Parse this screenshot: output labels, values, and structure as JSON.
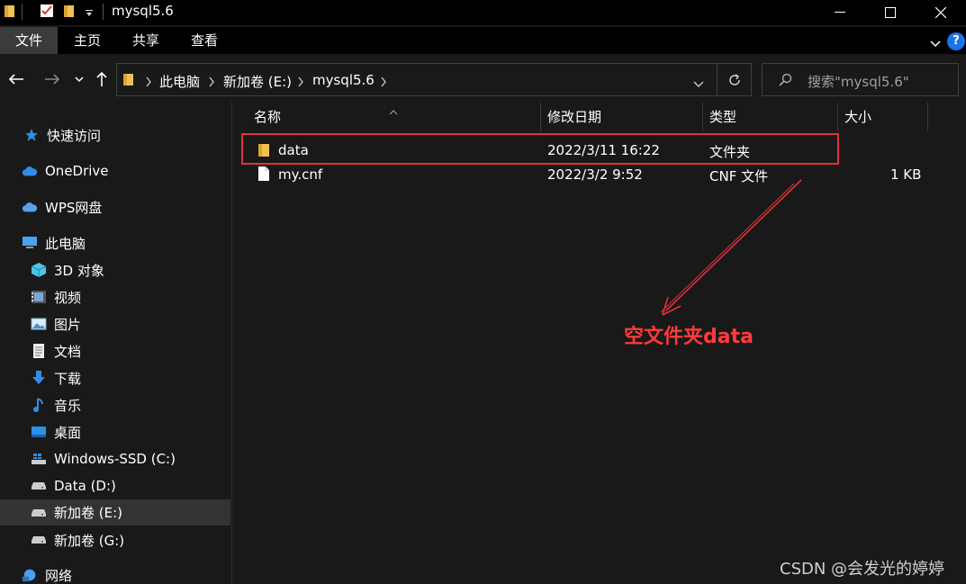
{
  "window": {
    "title": "mysql5.6",
    "minimize_glyph": "—",
    "maximize_glyph": "☐",
    "close_glyph": "✕"
  },
  "ribbon": {
    "tabs": [
      {
        "label": "文件",
        "active": true
      },
      {
        "label": "主页",
        "active": false
      },
      {
        "label": "共享",
        "active": false
      },
      {
        "label": "查看",
        "active": false
      }
    ],
    "help_glyph": "?"
  },
  "address": {
    "breadcrumbs": [
      "此电脑",
      "新加卷 (E:)",
      "mysql5.6"
    ]
  },
  "search": {
    "placeholder": "搜索\"mysql5.6\""
  },
  "sidebar": {
    "items": [
      {
        "label": "快速访问",
        "icon": "star-icon"
      },
      {
        "label": "OneDrive",
        "icon": "cloud-icon"
      },
      {
        "label": "WPS网盘",
        "icon": "cloud-icon"
      },
      {
        "label": "此电脑",
        "icon": "computer-icon"
      },
      {
        "label": "3D 对象",
        "icon": "cube-icon"
      },
      {
        "label": "视频",
        "icon": "video-icon"
      },
      {
        "label": "图片",
        "icon": "picture-icon"
      },
      {
        "label": "文档",
        "icon": "document-icon"
      },
      {
        "label": "下载",
        "icon": "download-icon"
      },
      {
        "label": "音乐",
        "icon": "music-icon"
      },
      {
        "label": "桌面",
        "icon": "desktop-icon"
      },
      {
        "label": "Windows-SSD (C:)",
        "icon": "windows-drive-icon"
      },
      {
        "label": "Data (D:)",
        "icon": "drive-icon"
      },
      {
        "label": "新加卷 (E:)",
        "icon": "drive-icon",
        "selected": true
      },
      {
        "label": "新加卷 (G:)",
        "icon": "drive-icon"
      },
      {
        "label": "网络",
        "icon": "network-icon"
      }
    ]
  },
  "columns": [
    "名称",
    "修改日期",
    "类型",
    "大小"
  ],
  "files": [
    {
      "name": "data",
      "modified": "2022/3/11 16:22",
      "type": "文件夹",
      "size": "",
      "icon": "folder-icon"
    },
    {
      "name": "my.cnf",
      "modified": "2022/3/2 9:52",
      "type": "CNF 文件",
      "size": "1 KB",
      "icon": "file-icon"
    }
  ],
  "annotation": {
    "text": "空文件夹data",
    "color": "#ff3b3b"
  },
  "watermark": "CSDN @会发光的婷婷",
  "colors": {
    "background": "#191919",
    "titlebar": "#000000",
    "selected": "#333333",
    "highlight_border": "#e0313b",
    "folder_yellow": "#f2c14e"
  }
}
